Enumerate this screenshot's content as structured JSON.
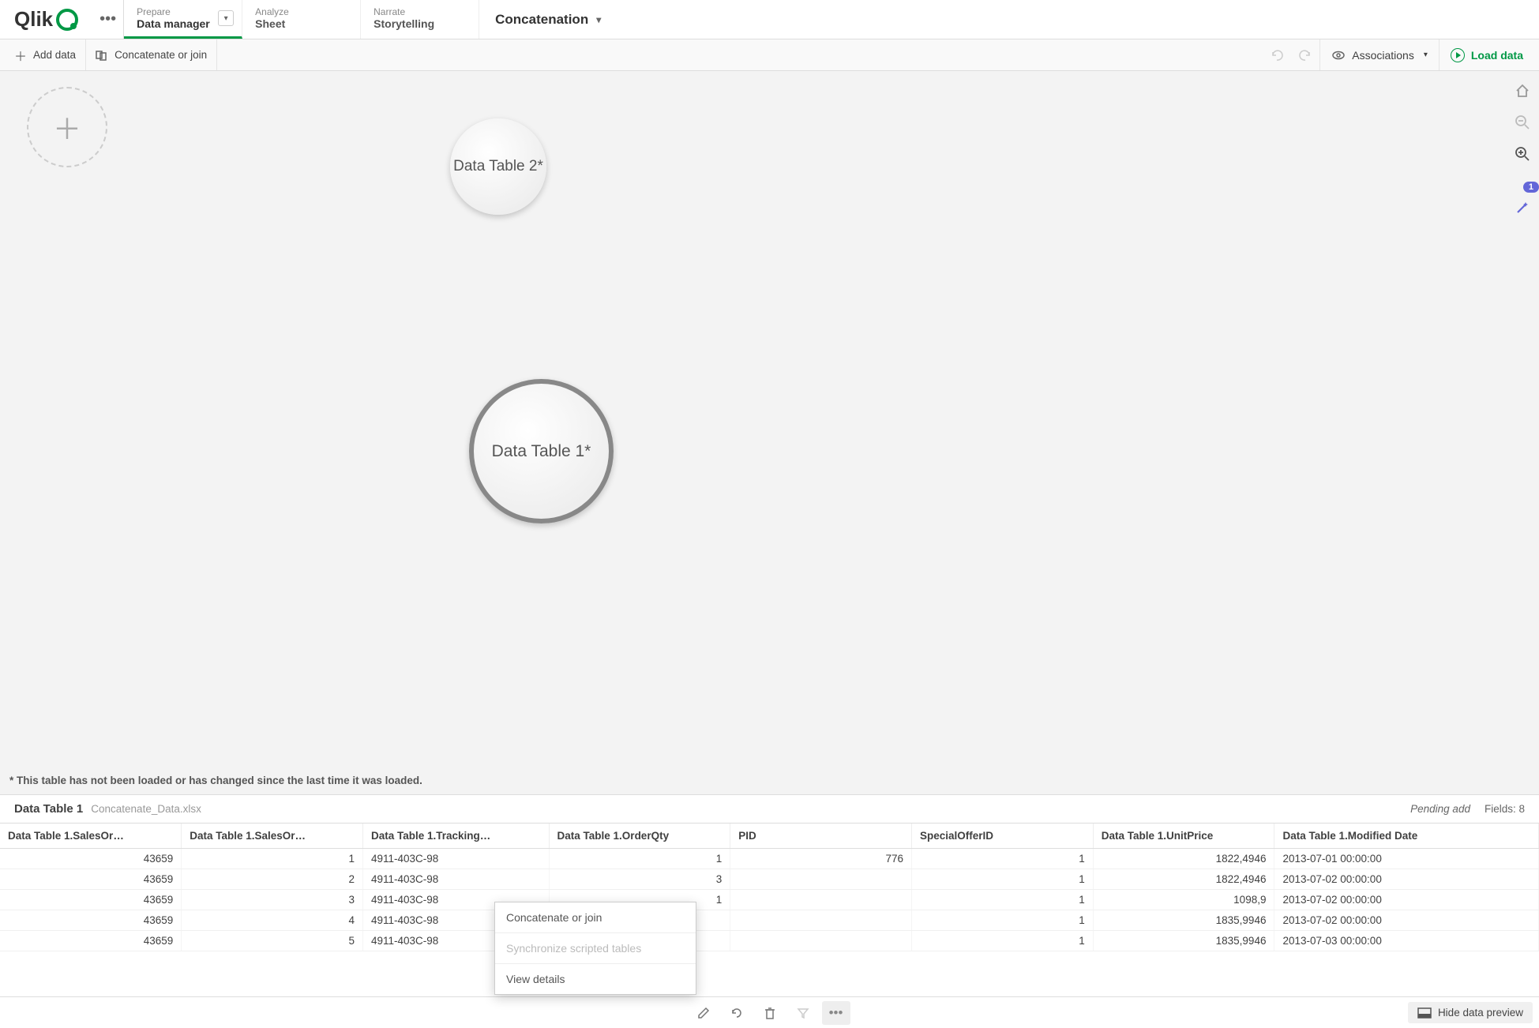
{
  "logo": "Qlik",
  "nav": {
    "prepare": {
      "sub": "Prepare",
      "main": "Data manager"
    },
    "analyze": {
      "sub": "Analyze",
      "main": "Sheet"
    },
    "narrate": {
      "sub": "Narrate",
      "main": "Storytelling"
    }
  },
  "app_name": "Concatenation",
  "toolbar": {
    "add_data": "Add data",
    "concat_join": "Concatenate or join",
    "associations": "Associations",
    "load_data": "Load data"
  },
  "canvas": {
    "bubble1": "Data Table 2*",
    "bubble2": "Data Table 1*",
    "footnote": "* This table has not been loaded or has changed since the last time it was loaded."
  },
  "side": {
    "badge_count": "1"
  },
  "preview": {
    "table_name": "Data Table 1",
    "file_name": "Concatenate_Data.xlsx",
    "pending": "Pending add",
    "fields_label": "Fields: 8"
  },
  "columns": [
    "Data Table 1.SalesOr…",
    "Data Table 1.SalesOr…",
    "Data Table 1.Tracking…",
    "Data Table 1.OrderQty",
    "PID",
    "SpecialOfferID",
    "Data Table 1.UnitPrice",
    "Data Table 1.Modified Date"
  ],
  "rows": [
    [
      "43659",
      "1",
      "4911-403C-98",
      "1",
      "776",
      "1",
      "1822,4946",
      "2013-07-01 00:00:00"
    ],
    [
      "43659",
      "2",
      "4911-403C-98",
      "3",
      "",
      "1",
      "1822,4946",
      "2013-07-02 00:00:00"
    ],
    [
      "43659",
      "3",
      "4911-403C-98",
      "1",
      "",
      "1",
      "1098,9",
      "2013-07-02 00:00:00"
    ],
    [
      "43659",
      "4",
      "4911-403C-98",
      "",
      "",
      "1",
      "1835,9946",
      "2013-07-02 00:00:00"
    ],
    [
      "43659",
      "5",
      "4911-403C-98",
      "",
      "",
      "1",
      "1835,9946",
      "2013-07-03 00:00:00"
    ]
  ],
  "context_menu": {
    "item1": "Concatenate or join",
    "item2": "Synchronize scripted tables",
    "item3": "View details"
  },
  "bottom": {
    "hide_preview": "Hide data preview"
  }
}
